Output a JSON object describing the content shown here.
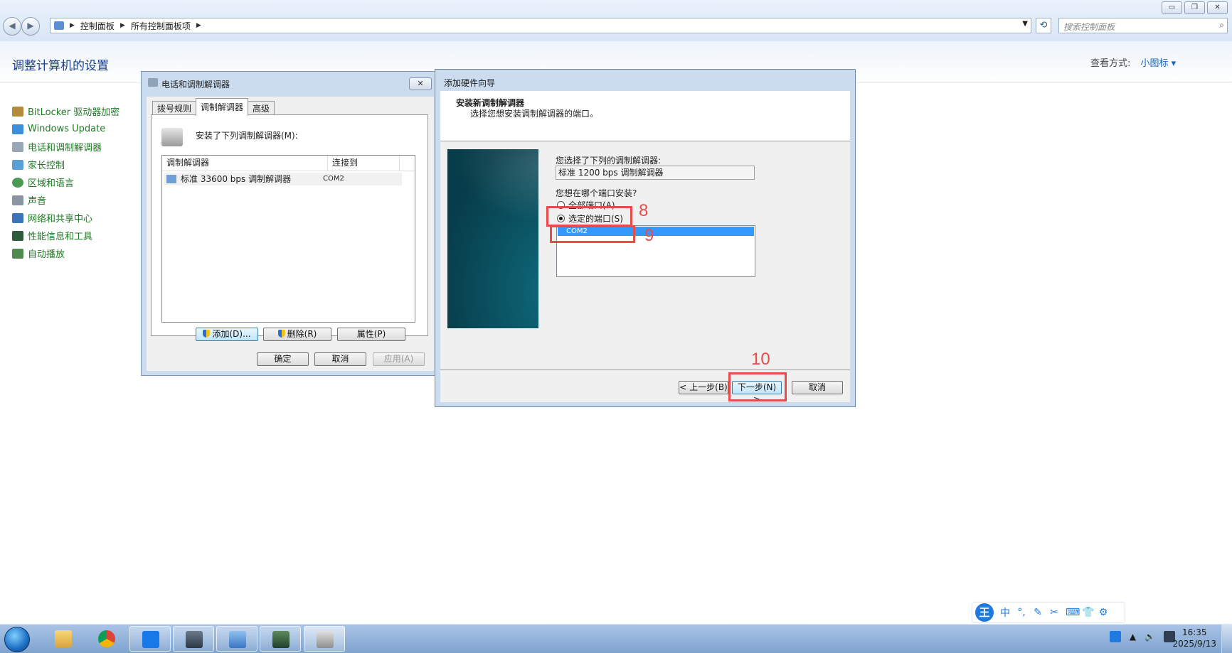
{
  "window": {
    "minimize_icon": "minimize-icon",
    "maximize_icon": "restore-icon",
    "close_icon": "close-icon"
  },
  "address": {
    "segments": [
      "控制面板",
      "所有控制面板项"
    ],
    "search_placeholder": "搜索控制面板"
  },
  "control_panel": {
    "title": "调整计算机的设置",
    "view_by_label": "查看方式:",
    "view_by_value": "小图标",
    "items": [
      {
        "label": "BitLocker 驱动器加密",
        "icon": "bitlocker-icon"
      },
      {
        "label": "Windows Update",
        "icon": "windows-update-icon"
      },
      {
        "label": "电话和调制解调器",
        "icon": "phone-modem-icon"
      },
      {
        "label": "家长控制",
        "icon": "parental-controls-icon"
      },
      {
        "label": "区域和语言",
        "icon": "region-language-icon"
      },
      {
        "label": "声音",
        "icon": "sound-icon"
      },
      {
        "label": "网络和共享中心",
        "icon": "network-icon"
      },
      {
        "label": "性能信息和工具",
        "icon": "performance-icon"
      },
      {
        "label": "自动播放",
        "icon": "autoplay-icon"
      }
    ]
  },
  "phone_modem_dialog": {
    "title": "电话和调制解调器",
    "tabs": [
      "拨号规则",
      "调制解调器",
      "高级"
    ],
    "installed_label": "安装了下列调制解调器(M):",
    "columns": [
      "调制解调器",
      "连接到"
    ],
    "rows": [
      {
        "modem": "标准 33600 bps 调制解调器",
        "port": "COM2"
      }
    ],
    "add_button": "添加(D)...",
    "remove_button": "删除(R)",
    "properties_button": "属性(P)",
    "ok_button": "确定",
    "cancel_button": "取消",
    "apply_button": "应用(A)"
  },
  "wizard": {
    "title": "添加硬件向导",
    "heading": "安装新调制解调器",
    "subheading": "选择您想安装调制解调器的端口。",
    "selected_label": "您选择了下列的调制解调器:",
    "selected_modem": "标准 1200 bps 调制解调器",
    "where_label": "您想在哪个端口安装?",
    "radio_all": "全部端口(A)",
    "radio_selected": "选定的端口(S)",
    "ports": [
      "COM2"
    ],
    "back_button": "< 上一步(B)",
    "next_button": "下一步(N) >",
    "cancel_button": "取消"
  },
  "annotations": [
    "8",
    "9",
    "10"
  ],
  "ime": {
    "logo": "王",
    "items": [
      "中",
      "°,",
      "✎",
      "✂",
      "⌨",
      "👕",
      "⚙"
    ]
  },
  "taskbar": {
    "time": "16:35",
    "date": "2025/9/13"
  },
  "colors": {
    "accent_link": "#1f7a25",
    "annotation": "#e94b4b",
    "selection": "#3399ff"
  }
}
